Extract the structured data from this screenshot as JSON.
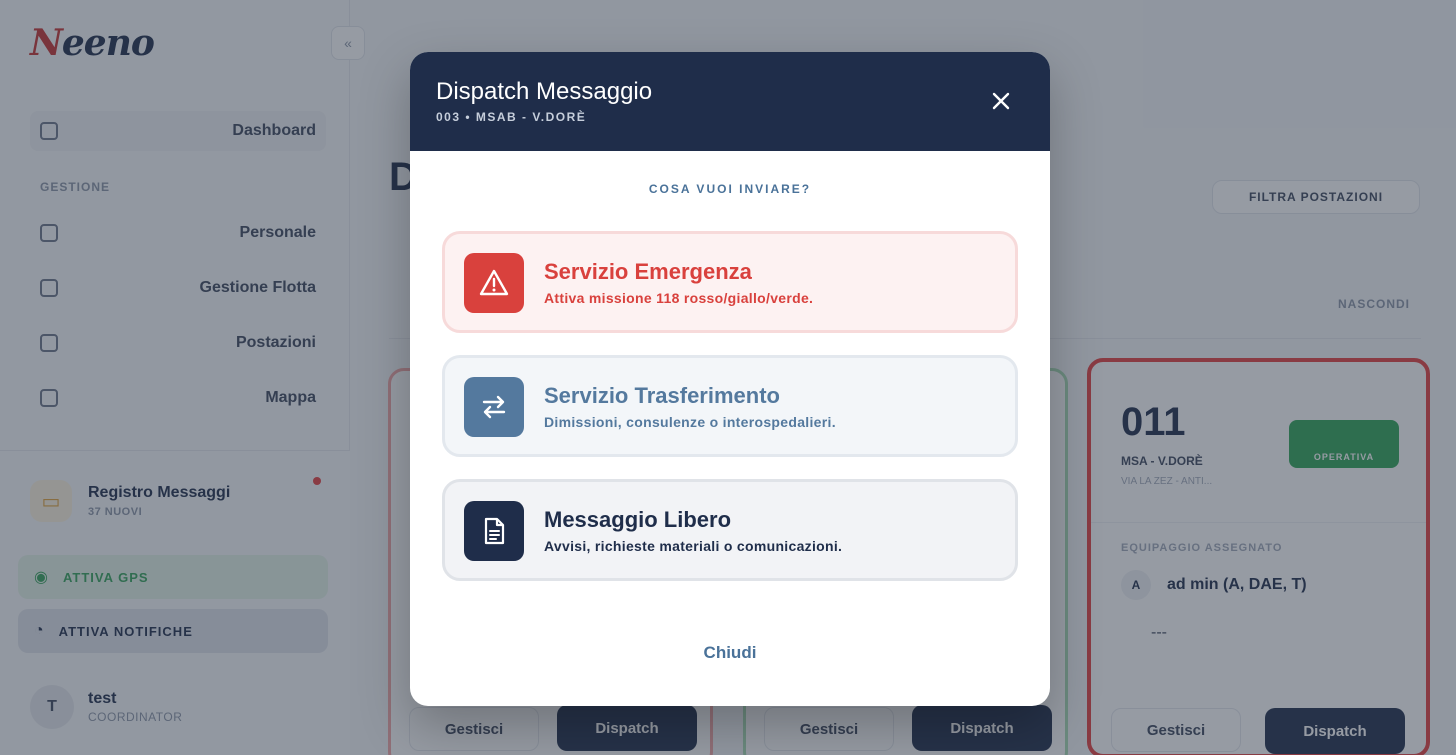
{
  "app": {
    "logo": "Neeno",
    "sidebar": {
      "items": [
        {
          "label": "Dashboard"
        },
        {
          "label": "Personale"
        },
        {
          "label": "Gestione Flotta"
        },
        {
          "label": "Postazioni"
        },
        {
          "label": "Mappa"
        }
      ],
      "section_label": "GESTIONE",
      "message_registry": {
        "title": "Registro Messaggi",
        "count": "37 NUOVI"
      },
      "gps_button": "ATTIVA GPS",
      "notifications_button": "ATTIVA NOTIFICHE",
      "user": {
        "initial": "T",
        "name": "test",
        "role": "COORDINATOR"
      }
    },
    "main": {
      "title_partial": "D",
      "filter_button": "FILTRA POSTAZIONI",
      "hide_link": "NASCONDI",
      "card": {
        "number": "011",
        "subtitle": "MSA - V.DORÈ",
        "detail": "VIA LA ZEZ - ANTI...",
        "status": "OPERATIVA",
        "crew_label": "EQUIPAGGIO ASSEGNATO",
        "crew_initial": "A",
        "crew_member": "ad min (A, DAE, T)",
        "crew_empty": "---"
      },
      "manage_button": "Gestisci",
      "dispatch_button": "Dispatch"
    }
  },
  "modal": {
    "title": "Dispatch Messaggio",
    "subtitle": "003 • MSAB - V.DORÈ",
    "question": "COSA VUOI INVIARE?",
    "options": [
      {
        "title": "Servizio Emergenza",
        "description": "Attiva missione 118 rosso/giallo/verde.",
        "icon": "warning-triangle-icon",
        "color": "#d9413d"
      },
      {
        "title": "Servizio Trasferimento",
        "description": "Dimissioni, consulenze o interospedalieri.",
        "icon": "transfer-arrows-icon",
        "color": "#54799e"
      },
      {
        "title": "Messaggio Libero",
        "description": "Avvisi, richieste materiali o comunicazioni.",
        "icon": "document-icon",
        "color": "#1f2d4a"
      }
    ],
    "close_label": "Chiudi"
  }
}
